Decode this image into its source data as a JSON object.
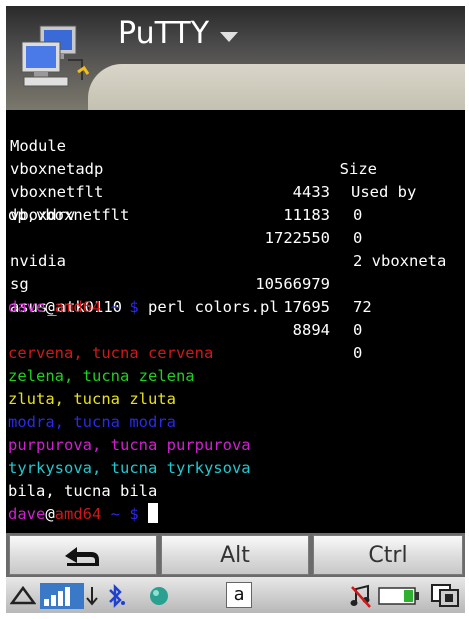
{
  "app": {
    "title": "PuTTY"
  },
  "terminal": {
    "header": {
      "module": "Module",
      "size": "Size",
      "used_by": "Used by"
    },
    "modules": [
      {
        "name": "vboxnetadp",
        "size": "4433",
        "used": "0"
      },
      {
        "name": "vboxnetflt",
        "size": "11183",
        "used": "0"
      },
      {
        "name": "vboxdrv",
        "size": "1722550",
        "used": "2 vboxneta"
      },
      {
        "name": "nvidia",
        "size": "10566979",
        "used": "72"
      },
      {
        "name": "sg",
        "size": "17695",
        "used": "0"
      },
      {
        "name": "asus_atk0110",
        "size": "8894",
        "used": "0"
      }
    ],
    "wrap_line": "dp,vboxnetflt",
    "prompt": {
      "user": "dave",
      "at": "@",
      "host": "amd64",
      "path": " ~ $ ",
      "command": "perl colors.pl"
    },
    "color_lines": [
      "cervena, tucna cervena",
      "zelena, tucna zelena",
      "zluta, tucna zluta",
      "modra, tucna modra",
      "purpurova, tucna purpurova",
      "tyrkysova, tucna tyrkysova",
      "bila, tucna bila"
    ],
    "colors": {
      "red": "#d01818",
      "green": "#20d020",
      "yellow": "#e8e020",
      "blue": "#2a2ae8",
      "magenta": "#d020d0",
      "cyan": "#20c8d0",
      "white": "#ffffff"
    }
  },
  "keys": {
    "back_icon": "back-arrow-icon",
    "alt": "Alt",
    "ctrl": "Ctrl"
  },
  "status": {
    "keyboard_label": "a"
  }
}
